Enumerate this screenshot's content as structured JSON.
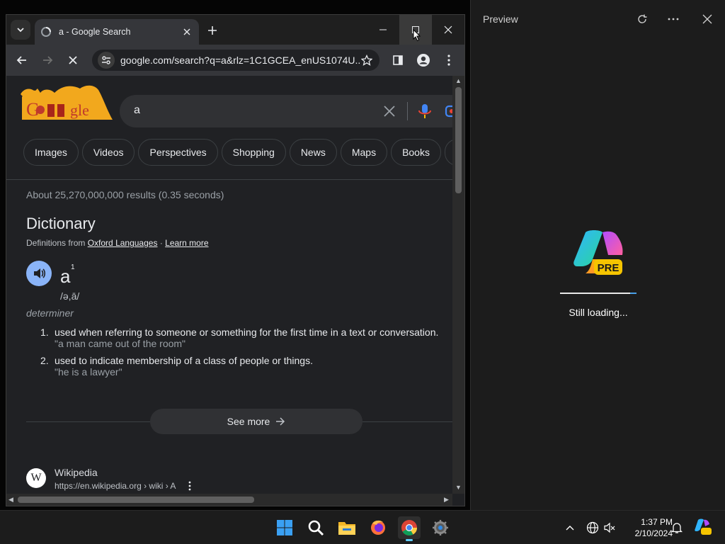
{
  "browser": {
    "tab_title": "a - Google Search",
    "url": "google.com/search?q=a&rlz=1C1GCEA_enUS1074U..."
  },
  "search": {
    "query": "a",
    "chips": [
      "Images",
      "Videos",
      "Perspectives",
      "Shopping",
      "News",
      "Maps",
      "Books",
      "I"
    ],
    "stats": "About 25,270,000,000 results (0.35 seconds)"
  },
  "dictionary": {
    "title": "Dictionary",
    "source_prefix": "Definitions from",
    "source_link": "Oxford Languages",
    "source_sep": "·",
    "learn_more": "Learn more",
    "word": "a",
    "superscript": "1",
    "phonetic": "/ə,ā/",
    "part_of_speech": "determiner",
    "definitions": [
      {
        "num": "1.",
        "text": "used when referring to someone or something for the first time in a text or conversation.",
        "example": "\"a man came out of the room\""
      },
      {
        "num": "2.",
        "text": "used to indicate membership of a class of people or things.",
        "example": "\"he is a lawyer\""
      }
    ],
    "see_more": "See more"
  },
  "result": {
    "site_name": "Wikipedia",
    "breadcrumb": "https://en.wikipedia.org › wiki › A",
    "icon_letter": "W"
  },
  "preview_pane": {
    "title": "Preview",
    "badge": "PRE",
    "loading_text": "Still loading...",
    "progress": 0.08
  },
  "taskbar": {
    "time": "1:37 PM",
    "date": "2/10/2024",
    "icons": [
      "windows-start-icon",
      "search-icon",
      "file-explorer-icon",
      "firefox-icon",
      "chrome-icon",
      "settings-icon"
    ]
  },
  "colors": {
    "page_bg": "#202124",
    "accent_blue": "#8ab4f8",
    "chip_border": "#3c4043"
  }
}
